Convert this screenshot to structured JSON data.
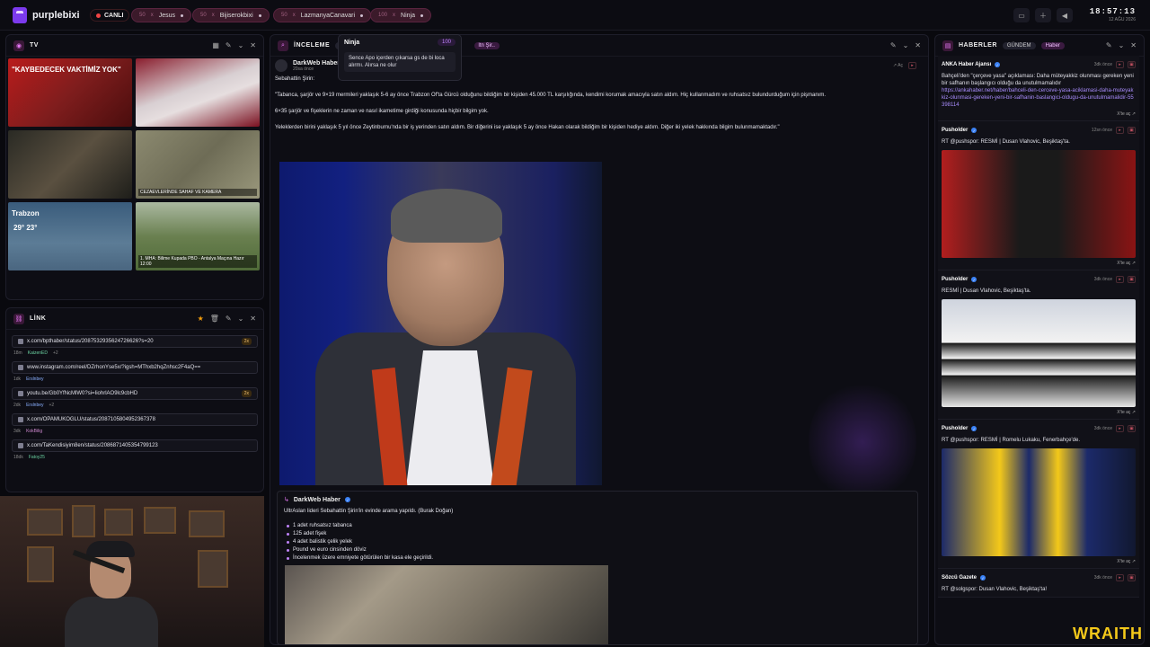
{
  "app": {
    "name": "purplebixi",
    "live_label": "CANLI"
  },
  "top_pills": [
    {
      "count": "50",
      "name": "Jesus"
    },
    {
      "count": "50",
      "name": "Bijiserokbixi"
    },
    {
      "count": "50",
      "name": "LazmanyaCanavari"
    },
    {
      "count": "100",
      "name": "Ninja"
    }
  ],
  "clock": {
    "time": "18:57:13",
    "date": "12 AĞU 2026"
  },
  "tv": {
    "title": "TV",
    "tiles": [
      {
        "headline": "\"KAYBEDECEK VAKTİMİZ YOK\"",
        "caption": ""
      },
      {
        "headline": "",
        "caption": ""
      },
      {
        "headline": "",
        "caption": ""
      },
      {
        "headline": "",
        "caption": "CEZAEVLERİNDE SAHAF VE KAMERA"
      },
      {
        "headline": "Trabzon",
        "temp": "29° 23°",
        "caption": ""
      },
      {
        "headline": "",
        "caption": "1. MHA: Bilime Kupada PBO - Antalya Maçına Hazır 12:00"
      }
    ]
  },
  "links": {
    "title": "LİNK",
    "items": [
      {
        "url": "x.com/bpthaber/status/2087532935624726626?s=20",
        "badge": "2x",
        "ago": "18m",
        "user": "KaizenED",
        "extra": "+2",
        "user_class": ""
      },
      {
        "url": "www.instagram.com/reel/DZrhonYse5x/?igsh=MThxb2hqZnhsc2F4aQ==",
        "badge": "",
        "ago": "1dk",
        "user": "Erslnbey",
        "extra": "",
        "user_class": "b"
      },
      {
        "url": "youtu.be/Gb0YfNcMlW0?si=IiohrlAO9lc9cbHD",
        "badge": "2x",
        "ago": "2dk",
        "user": "Erslnbey",
        "extra": "+2",
        "user_class": "b"
      },
      {
        "url": "x.com/OPAMUKOGLU/status/2087105804952367378",
        "badge": "",
        "ago": "3dk",
        "user": "KokBilig",
        "extra": "",
        "user_class": "p"
      },
      {
        "url": "x.com/TaKendisiyim8en/status/2086871405354799123",
        "badge": "",
        "ago": "18dk",
        "user": "Fatoy25",
        "extra": "",
        "user_class": ""
      }
    ]
  },
  "inceleme": {
    "title": "İNCELEME",
    "tags": [
      "ultr",
      "ltn Şir.."
    ],
    "post1": {
      "author": "DarkWeb Haber",
      "ago": "20sa önce",
      "action": "Aç",
      "intro": "Sebahattin Şirin:",
      "p1": "\"Tabanca, şarjör ve 9×19 mermileri yaklaşık 5-6 ay önce Trabzon Of'ta Gürcü olduğunu bildiğim bir kişiden 45.000 TL karşılığında, kendimi korumak amacıyla satın aldım. Hiç kullanmadım ve ruhsatsız bulundurduğum için pişmanım.",
      "p2": "6×35 şarjör ve fişeklerin ne zaman ve nasıl ikametime girdiği konusunda hiçbir bilgim yok.",
      "p3": "Yeleklerden birini yaklaşık 5 yıl önce Zeytinburnu'nda bir iş yerinden satın aldım. Bir diğerini ise yaklaşık 5 ay önce Hakan olarak bildiğim bir kişiden hediye aldım. Diğer iki yelek hakkında bilgim bulunmamaktadır.\""
    },
    "post2": {
      "author": "DarkWeb Haber",
      "intro": "UltrAslan lideri Sebahattin Şirin'in evinde arama yapıldı. (Burak Doğan)",
      "items": [
        "1 adet ruhsatsız tabanca",
        "125 adet fişek",
        "4 adet balistik çelik yelek",
        "Pound ve euro cinsinden döviz",
        "İncelenmek üzere emniyete götürülen bir kasa ele geçirildi."
      ]
    }
  },
  "tooltip": {
    "title": "Ninja",
    "count": "100",
    "body": "Sence Apo içerden çıkarsa gs de bi loca alırmı. Alırsa ne olur"
  },
  "haberler": {
    "title": "HABERLER",
    "tabs": [
      "GÜNDEM",
      "Haber"
    ],
    "cards": [
      {
        "source": "ANKA Haber Ajansı",
        "ago": "3dk önce",
        "text": "Bahçeli'den \"çerçeve yasa\" açıklaması: Daha müteyakkiz olunması gereken yeni bir safhanın başlangıcı olduğu da unutulmamalıdır",
        "link": "https://ankahaber.net/haber/bahceli-den-cerceve-yasa-aciklamasi-daha-muteyakkiz-olunmasi-gereken-yeni-bir-safhanin-baslangici-oldugu-da-unutulmamalidir-55398114",
        "footer": "X'te aç",
        "image": ""
      },
      {
        "source": "Pusholder",
        "ago": "12sn önce",
        "text": "RT @pushspor: RESMİ | Dusan Vlahovic, Beşiktaş'ta.",
        "link": "",
        "footer": "X'te aç",
        "image": "img-bjk1"
      },
      {
        "source": "Pusholder",
        "ago": "3dk önce",
        "text": "RESMİ | Dusan Vlahovic, Beşiktaş'ta.",
        "link": "",
        "footer": "X'te aç",
        "image": "img-bjk2"
      },
      {
        "source": "Pusholder",
        "ago": "3dk önce",
        "text": "RT @pushspor: RESMİ | Romelu Lukaku, Fenerbahçe'de.",
        "link": "",
        "footer": "X'te aç",
        "image": "img-fb"
      },
      {
        "source": "Sözcü Gazete",
        "ago": "3dk önce",
        "text": "RT @solgspor: Dusan Vlahovic, Beşiktaş'ta!",
        "link": "",
        "footer": "",
        "image": ""
      }
    ]
  },
  "watermark": "WRAITH"
}
